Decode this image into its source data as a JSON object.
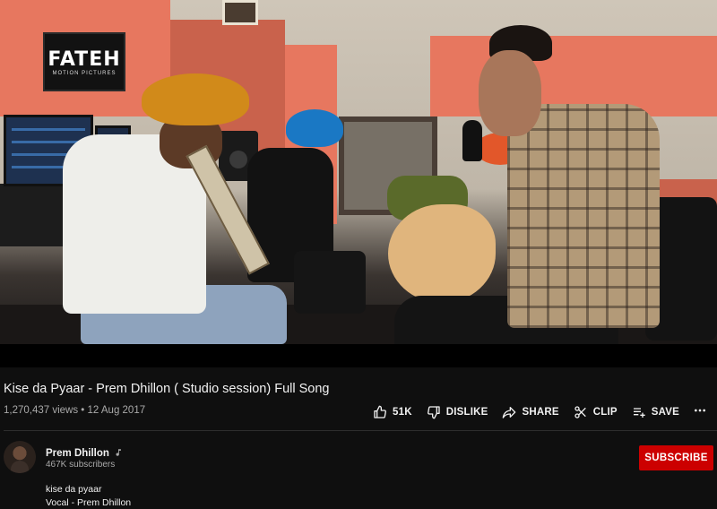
{
  "video": {
    "scene_logo_text": "FATEH",
    "scene_logo_sub": "MOTION PICTURES"
  },
  "info": {
    "title": "Kise da Pyaar - Prem Dhillon ( Studio session) Full Song",
    "views": "1,270,437 views",
    "separator": "•",
    "date": "12 Aug 2017",
    "meta_line": "1,270,437 views • 12 Aug 2017"
  },
  "actions": {
    "like": {
      "label": "51K",
      "icon": "thumbs-up-icon"
    },
    "dislike": {
      "label": "DISLIKE",
      "icon": "thumbs-down-icon"
    },
    "share": {
      "label": "SHARE",
      "icon": "share-icon"
    },
    "clip": {
      "label": "CLIP",
      "icon": "scissors-icon"
    },
    "save": {
      "label": "SAVE",
      "icon": "playlist-add-icon"
    },
    "more": {
      "icon": "more-horizontal-icon"
    }
  },
  "channel": {
    "name": "Prem Dhillon",
    "badge_icon": "music-note-icon",
    "subscribers": "467K subscribers",
    "subscribe_label": "SUBSCRIBE"
  },
  "description": {
    "lines": [
      "kise da pyaar",
      "Vocal - Prem Dhillon"
    ]
  },
  "colors": {
    "background": "#0f0f0f",
    "text_primary": "#f1f1f1",
    "text_secondary": "#aaaaaa",
    "subscribe_red": "#cc0000",
    "divider": "#2e2e2e"
  }
}
